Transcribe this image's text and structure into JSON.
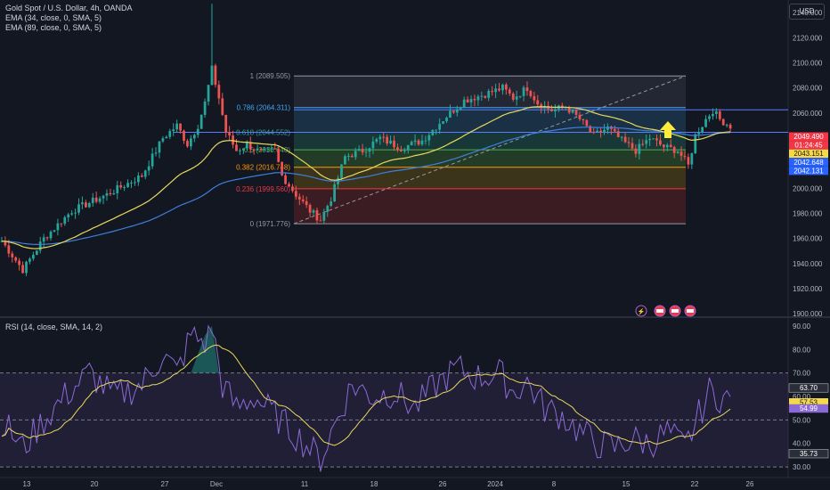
{
  "header": {
    "title": "Gold Spot / U.S. Dollar, 4h, OANDA",
    "ema1": "EMA (34, close, 0, SMA, 5)",
    "ema2": "EMA (89, close, 0, SMA, 5)",
    "currency": "USD"
  },
  "rsi_header": "RSI (14, close, SMA, 14, 2)",
  "colors": {
    "background": "#131722",
    "up_candle": "#26a69a",
    "down_candle": "#ef5350",
    "ema34": "#e8d85b",
    "ema89": "#3d7fdc",
    "rsi_line": "#8c6ad6",
    "rsi_sma": "#e8d85b"
  },
  "chart_data": [
    {
      "type": "candlestick",
      "title": "Gold Spot / U.S. Dollar, 4h, OANDA",
      "y_axis_ticks": [
        2140,
        2120,
        2100,
        2080,
        2060,
        2040,
        2020,
        2000,
        1980,
        1960,
        1940,
        1920,
        1900
      ],
      "y_axis_tick_labels": [
        "2140.000",
        "2120.000",
        "2100.000",
        "2080.000",
        "2060.000",
        "2040.000",
        "2020.000",
        "2000.000",
        "1980.000",
        "1960.000",
        "1940.000",
        "1920.000",
        "1900.000"
      ],
      "ylim": [
        1898,
        2150
      ],
      "x_axis_ticks": [
        "13",
        "20",
        "27",
        "Dec",
        "11",
        "18",
        "26",
        "2024",
        "8",
        "15",
        "22",
        "26"
      ],
      "price_anchors": [
        [
          0,
          1958
        ],
        [
          6,
          1935
        ],
        [
          12,
          1960
        ],
        [
          20,
          1982
        ],
        [
          30,
          1995
        ],
        [
          40,
          2010
        ],
        [
          46,
          2040
        ],
        [
          50,
          2050
        ],
        [
          53,
          2035
        ],
        [
          56,
          2050
        ],
        [
          58,
          2068
        ],
        [
          60,
          2095
        ],
        [
          62,
          2072
        ],
        [
          64,
          2045
        ],
        [
          67,
          2030
        ],
        [
          70,
          2035
        ],
        [
          74,
          2028
        ],
        [
          78,
          2030
        ],
        [
          80,
          2010
        ],
        [
          84,
          1995
        ],
        [
          88,
          1982
        ],
        [
          91,
          1975
        ],
        [
          94,
          1992
        ],
        [
          98,
          2025
        ],
        [
          103,
          2030
        ],
        [
          108,
          2040
        ],
        [
          114,
          2032
        ],
        [
          120,
          2038
        ],
        [
          126,
          2055
        ],
        [
          132,
          2070
        ],
        [
          138,
          2075
        ],
        [
          143,
          2080
        ],
        [
          146,
          2072
        ],
        [
          150,
          2080
        ],
        [
          153,
          2068
        ],
        [
          157,
          2062
        ],
        [
          161,
          2065
        ],
        [
          165,
          2055
        ],
        [
          169,
          2042
        ],
        [
          173,
          2048
        ],
        [
          177,
          2038
        ],
        [
          181,
          2030
        ],
        [
          185,
          2040
        ],
        [
          189,
          2033
        ],
        [
          193,
          2030
        ],
        [
          196,
          2018
        ],
        [
          198,
          2042
        ],
        [
          201,
          2055
        ],
        [
          203,
          2062
        ],
        [
          205,
          2055
        ],
        [
          208,
          2049.49
        ]
      ],
      "spike_high": 2147,
      "current_price": "2049.490",
      "countdown": "01:24:45",
      "price_labels": [
        {
          "text": "2049.490",
          "color": "#f23645",
          "value": 2049.49
        },
        {
          "text": "01:24:45",
          "color": "#f23645",
          "value": 2046.3
        },
        {
          "text": "2043.151",
          "color": "#f7d84a",
          "value": 2043.151
        },
        {
          "text": "2042.648",
          "color": "#2962ff",
          "value": 2042.648
        },
        {
          "text": "2042.131",
          "color": "#2962ff",
          "value": 2042.131
        }
      ],
      "fibonacci": {
        "levels": [
          {
            "ratio": "1",
            "price": 2089.505,
            "label": "1 (2089.505)",
            "color": "#9598a1",
            "fill": "#2a2e39"
          },
          {
            "ratio": "0.786",
            "price": 2064.311,
            "label": "0.786 (2064.311)",
            "color": "#42a5f5",
            "fill": "#1e3a52"
          },
          {
            "ratio": "0.618",
            "price": 2044.552,
            "label": "0.618 (2044.552)",
            "color": "#26a69a",
            "fill": "#1b4440"
          },
          {
            "ratio": "0.5",
            "price": 2030.64,
            "label": "0.5 (2030.640)",
            "color": "#4caf50",
            "fill": "#2a4a2a"
          },
          {
            "ratio": "0.382",
            "price": 2016.748,
            "label": "0.382 (2016.748)",
            "color": "#ff9800",
            "fill": "#4a3f1a"
          },
          {
            "ratio": "0.236",
            "price": 1999.56,
            "label": "0.236 (1999.560)",
            "color": "#f23645",
            "fill": "#4a1f24"
          },
          {
            "ratio": "0",
            "price": 1971.776,
            "label": "0 (1971.776)",
            "color": "#9598a1",
            "fill": ""
          }
        ]
      },
      "ema_lines": [
        "EMA 34",
        "EMA 89"
      ]
    },
    {
      "type": "line",
      "title": "RSI (14, close, SMA, 14, 2)",
      "y_axis_ticks": [
        90,
        80,
        70,
        60,
        50,
        40,
        30
      ],
      "y_axis_tick_labels": [
        "90.00",
        "80.00",
        "70.00",
        "60.00",
        "50.00",
        "40.00",
        "30.00"
      ],
      "ylim": [
        27,
        93
      ],
      "band": [
        30,
        70
      ],
      "labels": [
        {
          "text": "63.70",
          "color": "#2a2e39",
          "value": 63.7
        },
        {
          "text": "57.53",
          "color": "#f7d84a",
          "value": 57.53
        },
        {
          "text": "54.99",
          "color": "#8c6ad6",
          "value": 54.99
        },
        {
          "text": "35.73",
          "color": "#2a2e39",
          "value": 35.73
        }
      ],
      "anchors": [
        [
          0,
          50
        ],
        [
          6,
          38
        ],
        [
          12,
          50
        ],
        [
          18,
          60
        ],
        [
          25,
          70
        ],
        [
          32,
          60
        ],
        [
          40,
          65
        ],
        [
          46,
          78
        ],
        [
          50,
          70
        ],
        [
          54,
          86
        ],
        [
          58,
          83
        ],
        [
          60,
          90
        ],
        [
          63,
          65
        ],
        [
          67,
          55
        ],
        [
          72,
          60
        ],
        [
          78,
          52
        ],
        [
          83,
          45
        ],
        [
          88,
          38
        ],
        [
          91,
          33
        ],
        [
          95,
          48
        ],
        [
          100,
          65
        ],
        [
          106,
          60
        ],
        [
          112,
          62
        ],
        [
          118,
          55
        ],
        [
          124,
          65
        ],
        [
          130,
          72
        ],
        [
          136,
          68
        ],
        [
          142,
          70
        ],
        [
          146,
          62
        ],
        [
          150,
          66
        ],
        [
          155,
          55
        ],
        [
          160,
          52
        ],
        [
          165,
          45
        ],
        [
          170,
          40
        ],
        [
          175,
          38
        ],
        [
          180,
          42
        ],
        [
          185,
          40
        ],
        [
          190,
          45
        ],
        [
          195,
          38
        ],
        [
          199,
          52
        ],
        [
          202,
          62
        ],
        [
          205,
          60
        ],
        [
          208,
          58
        ]
      ]
    }
  ],
  "icons": [
    "lightning-icon",
    "us-flag-event-icon"
  ]
}
